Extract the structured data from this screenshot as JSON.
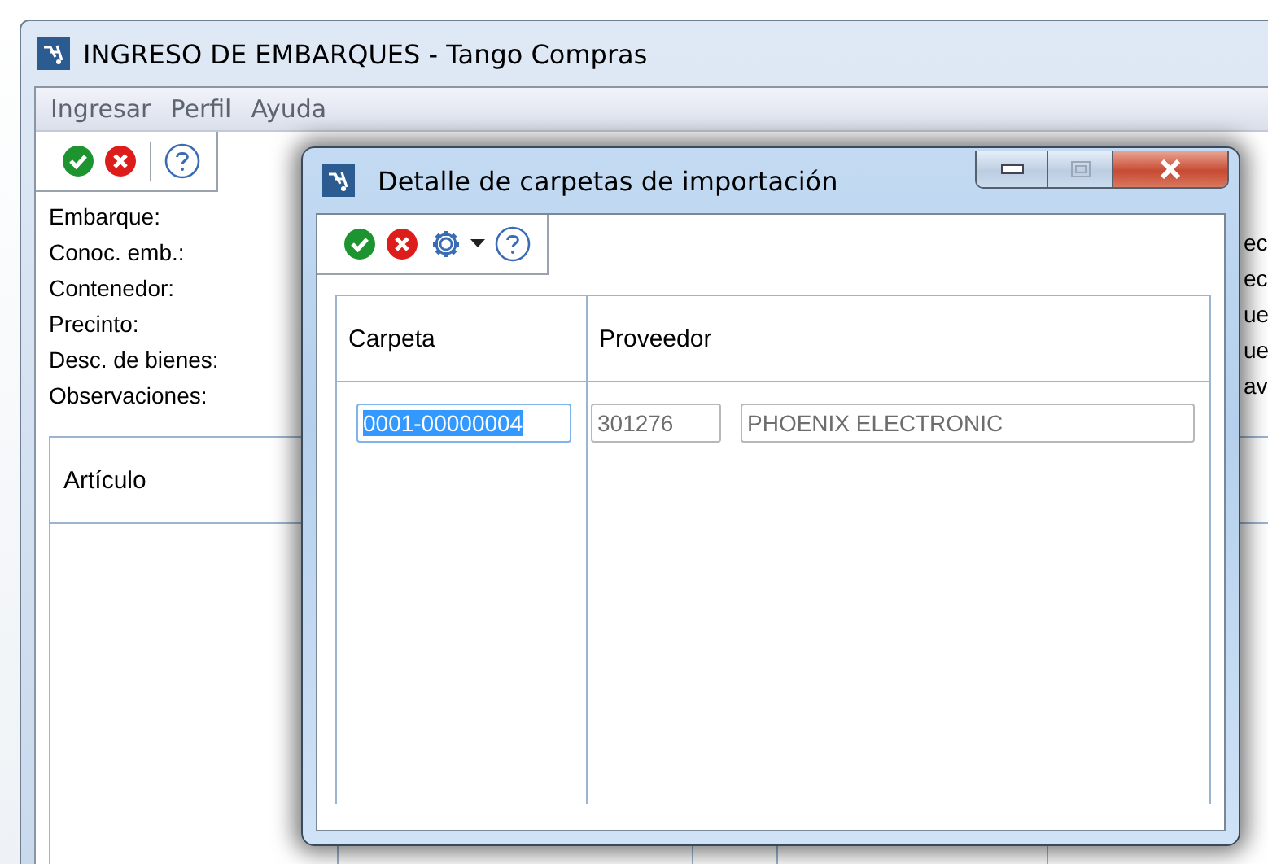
{
  "main_window": {
    "title": "INGRESO DE EMBARQUES - Tango Compras",
    "menu": [
      "Ingresar",
      "Perfil",
      "Ayuda"
    ],
    "field_labels": [
      "Embarque:",
      "Conoc. emb.:",
      "Contenedor:",
      "Precinto:",
      "Desc. de bienes:",
      "Observaciones:"
    ],
    "column_2_fragments": [
      "ec",
      "ec",
      "ue",
      "ue",
      "av"
    ],
    "table": {
      "columns": [
        "Artículo"
      ]
    }
  },
  "dialog": {
    "title": "Detalle de carpetas de importación",
    "table": {
      "columns": [
        "Carpeta",
        "Proveedor"
      ],
      "rows": [
        {
          "carpeta": "0001-00000004",
          "text_selected": true,
          "supplier_code": "301276",
          "supplier_name": "PHOENIX ELECTRONIC"
        }
      ]
    }
  }
}
